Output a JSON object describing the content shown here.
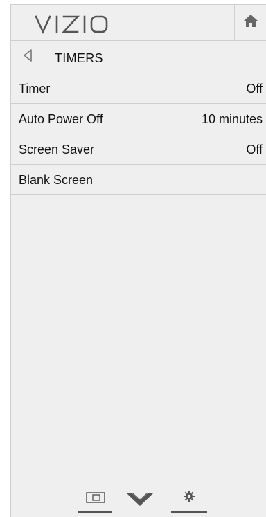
{
  "brand": {
    "logo_text": "VIZIO"
  },
  "header": {
    "home_icon": "home-icon"
  },
  "titlebar": {
    "back_icon": "back-triangle-icon",
    "title": "TIMERS"
  },
  "menu": {
    "items": [
      {
        "label": "Timer",
        "value": "Off"
      },
      {
        "label": "Auto Power Off",
        "value": "10 minutes"
      },
      {
        "label": "Screen Saver",
        "value": "Off"
      },
      {
        "label": "Blank Screen",
        "value": ""
      }
    ]
  },
  "bottom_nav": {
    "items": [
      {
        "icon": "input-icon"
      },
      {
        "icon": "vizio-v-icon"
      },
      {
        "icon": "gear-icon"
      }
    ]
  },
  "colors": {
    "panel_bg": "#efefef",
    "divider": "#cfcfcf",
    "text": "#111111",
    "icon": "#555555"
  }
}
